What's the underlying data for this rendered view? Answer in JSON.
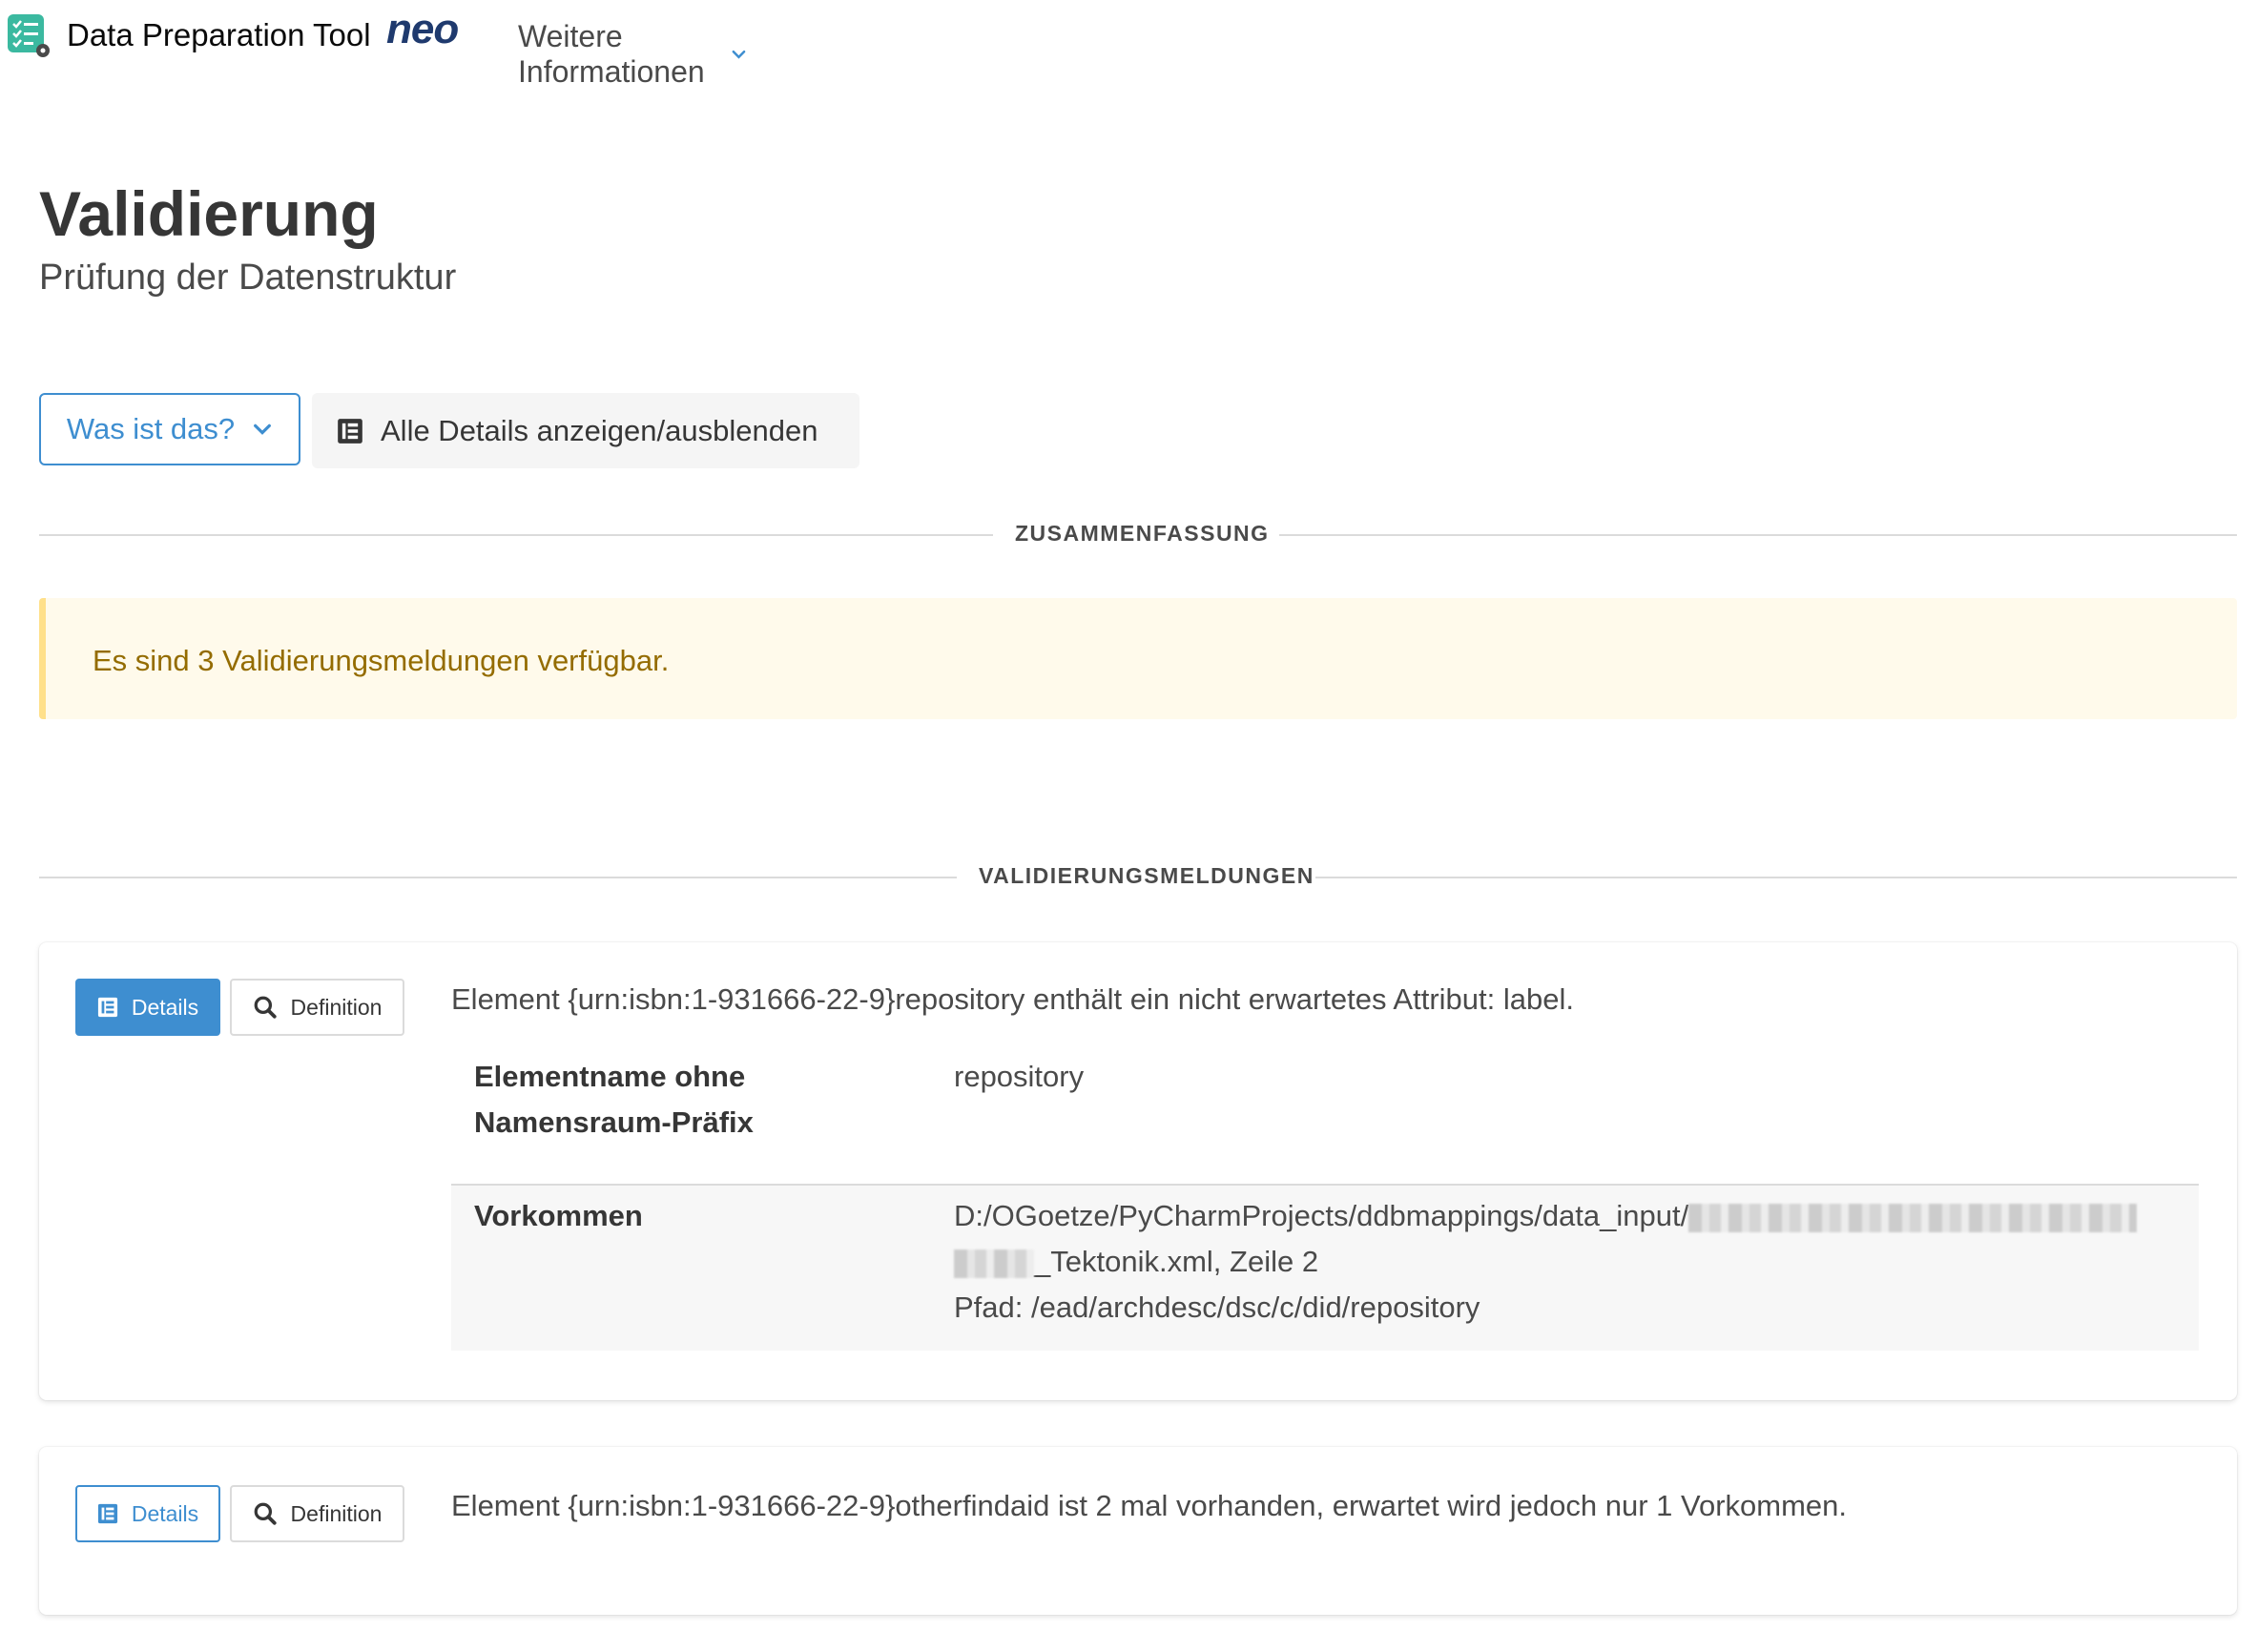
{
  "navbar": {
    "brand_title": "Data Preparation Tool",
    "brand_logo_text": "neo",
    "more_info_label": "Weitere Informationen"
  },
  "header": {
    "title": "Validierung",
    "subtitle": "Prüfung der Datenstruktur"
  },
  "toolbar": {
    "what_is_this_label": "Was ist das?",
    "toggle_details_label": "Alle Details anzeigen/ausblenden"
  },
  "summary": {
    "divider_label": "ZUSAMMENFASSUNG",
    "notice_text": "Es sind 3 Validierungsmeldungen verfügbar."
  },
  "messages_section": {
    "divider_label": "VALIDIERUNGSMELDUNGEN",
    "details_label": "Details",
    "definition_label": "Definition",
    "items": [
      {
        "text": "Element {urn:isbn:1-931666-22-9}repository enthält ein nicht erwartetes Attribut: label.",
        "expanded": true,
        "details": {
          "row1_key_line1": "Elementname ohne",
          "row1_key_line2": "Namensraum-Präfix",
          "row1_value": "repository",
          "row2_key": "Vorkommen",
          "row2_value_line1": "D:/OGoetze/PyCharmProjects/ddbmappings/data_input/",
          "row2_value_line2_suffix": "_Tektonik.xml, Zeile 2",
          "row2_value_line3": "Pfad: /ead/archdesc/dsc/c/did/repository"
        }
      },
      {
        "text": "Element {urn:isbn:1-931666-22-9}otherfindaid ist 2 mal vorhanden, erwartet wird jedoch nur 1 Vorkommen.",
        "expanded": false
      }
    ]
  },
  "colors": {
    "primary": "#3e8ed0",
    "warning_bg": "#fffaeb",
    "warning_text": "#946c00",
    "warning_border": "#ffe08a",
    "logo_teal": "#3bb9a0"
  }
}
